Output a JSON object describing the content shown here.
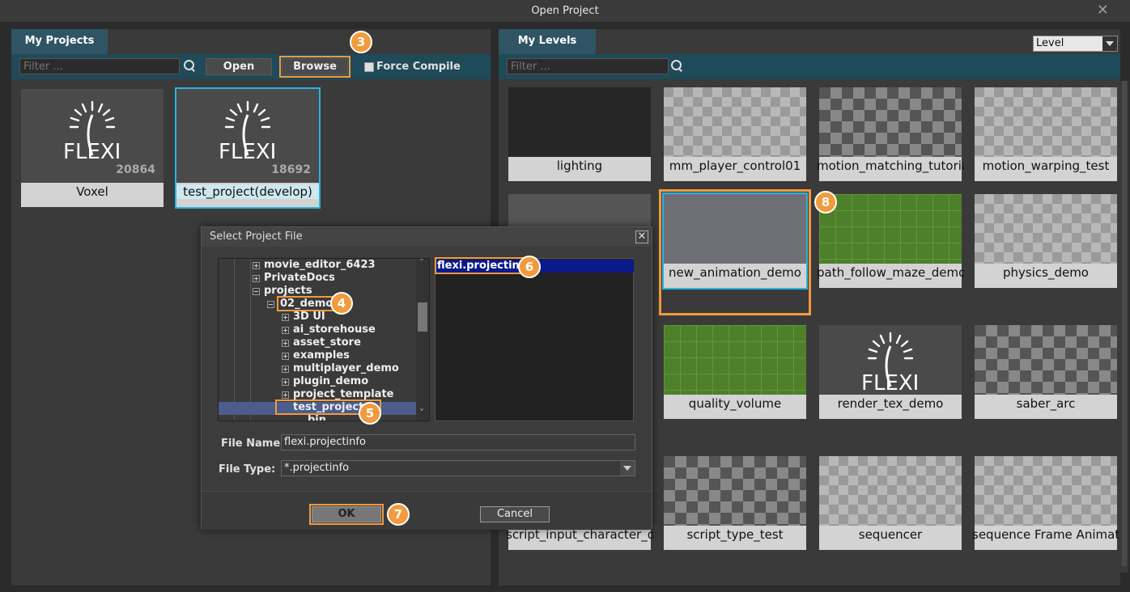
{
  "window": {
    "title": "Open Project"
  },
  "projects_panel": {
    "tab": "My Projects",
    "filter_placeholder": "Filter ...",
    "open_label": "Open",
    "browse_label": "Browse",
    "force_compile_label": "Force Compile",
    "projects": [
      {
        "name": "Voxel",
        "number": "20864"
      },
      {
        "name": "test_project(develop)",
        "number": "18692"
      }
    ]
  },
  "levels_panel": {
    "tab": "My Levels",
    "filter_placeholder": "Filter ...",
    "combo_value": "Level",
    "levels": [
      "lighting",
      "mm_player_control01",
      "motion_matching_tutorial",
      "motion_warping_test",
      "",
      "new_animation_demo",
      "path_follow_maze_demo",
      "physics_demo",
      "quality_volume",
      "render_tex_demo",
      "saber_arc",
      "script_input_character_demo",
      "script_type_test",
      "sequencer",
      "sequence Frame Animation"
    ]
  },
  "dialog": {
    "title": "Select Project File",
    "tree": [
      "movie_editor_6423",
      "PrivateDocs",
      "projects",
      "02_demo",
      "3D UI",
      "ai_storehouse",
      "asset_store",
      "examples",
      "multiplayer_demo",
      "plugin_demo",
      "project_template",
      "test_project",
      "bin"
    ],
    "file_selected": "flexi.projectinfo",
    "file_name_label": "File Name:",
    "file_name_value": "flexi.projectinfo",
    "file_type_label": "File Type:",
    "file_type_value": "*.projectinfo",
    "ok_label": "OK",
    "cancel_label": "Cancel"
  },
  "badges": [
    "3",
    "4",
    "5",
    "6",
    "7",
    "8"
  ],
  "logo_text": "FLEXI",
  "colors": {
    "accent": "#f39a3c",
    "tab": "#2f5464",
    "selection": "#27b5e0"
  }
}
